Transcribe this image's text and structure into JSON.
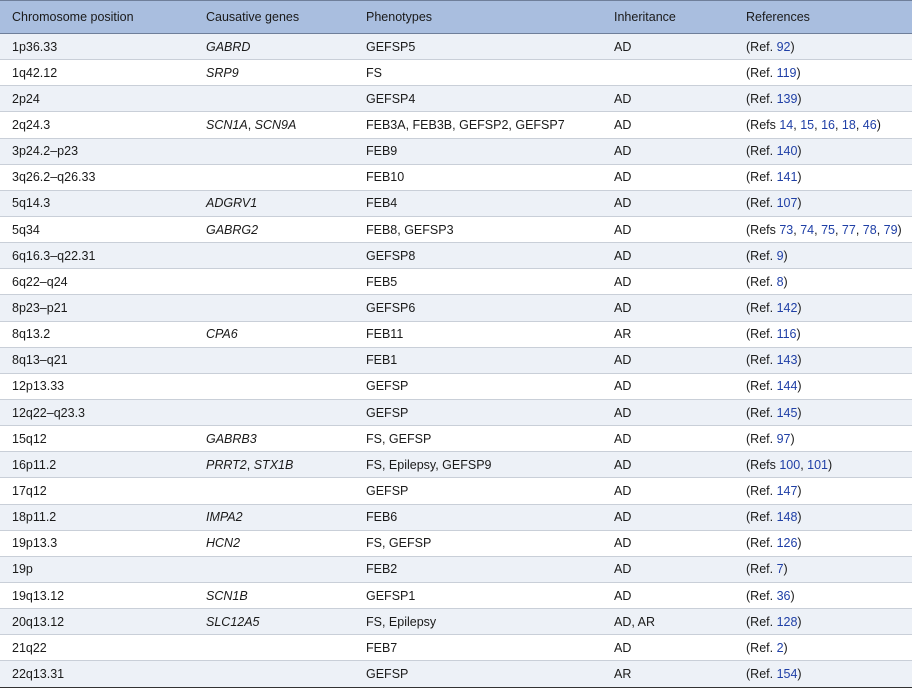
{
  "headers": {
    "position": "Chromosome position",
    "genes": "Causative genes",
    "phenotypes": "Phenotypes",
    "inheritance": "Inheritance",
    "references": "References"
  },
  "rows": [
    {
      "position": "1p36.33",
      "genes": [
        {
          "text": "GABRD",
          "italic": true
        }
      ],
      "phenotypes": "GEFSP5",
      "inheritance": "AD",
      "ref_prefix": "(Ref. ",
      "refs": [
        "92"
      ],
      "ref_suffix": ")"
    },
    {
      "position": "1q42.12",
      "genes": [
        {
          "text": "SRP9",
          "italic": true
        }
      ],
      "phenotypes": "FS",
      "inheritance": "",
      "ref_prefix": "(Ref. ",
      "refs": [
        "119"
      ],
      "ref_suffix": ")"
    },
    {
      "position": "2p24",
      "genes": [],
      "phenotypes": "GEFSP4",
      "inheritance": "AD",
      "ref_prefix": "(Ref. ",
      "refs": [
        "139"
      ],
      "ref_suffix": ")"
    },
    {
      "position": "2q24.3",
      "genes": [
        {
          "text": "SCN1A",
          "italic": true
        },
        {
          "text": ", ",
          "italic": false
        },
        {
          "text": "SCN9A",
          "italic": true
        }
      ],
      "phenotypes": "FEB3A, FEB3B, GEFSP2, GEFSP7",
      "inheritance": "AD",
      "ref_prefix": "(Refs ",
      "refs": [
        "14",
        "15",
        "16",
        "18",
        "46"
      ],
      "ref_suffix": ")"
    },
    {
      "position": "3p24.2–p23",
      "genes": [],
      "phenotypes": "FEB9",
      "inheritance": "AD",
      "ref_prefix": "(Ref. ",
      "refs": [
        "140"
      ],
      "ref_suffix": ")"
    },
    {
      "position": "3q26.2–q26.33",
      "genes": [],
      "phenotypes": "FEB10",
      "inheritance": "AD",
      "ref_prefix": "(Ref. ",
      "refs": [
        "141"
      ],
      "ref_suffix": ")"
    },
    {
      "position": "5q14.3",
      "genes": [
        {
          "text": "ADGRV1",
          "italic": true
        }
      ],
      "phenotypes": "FEB4",
      "inheritance": "AD",
      "ref_prefix": "(Ref. ",
      "refs": [
        "107"
      ],
      "ref_suffix": ")"
    },
    {
      "position": "5q34",
      "genes": [
        {
          "text": "GABRG2",
          "italic": true
        }
      ],
      "phenotypes": "FEB8, GEFSP3",
      "inheritance": "AD",
      "ref_prefix": "(Refs ",
      "refs": [
        "73",
        "74",
        "75",
        "77",
        "78",
        "79"
      ],
      "ref_suffix": ")"
    },
    {
      "position": "6q16.3–q22.31",
      "genes": [],
      "phenotypes": "GEFSP8",
      "inheritance": "AD",
      "ref_prefix": "(Ref. ",
      "refs": [
        "9"
      ],
      "ref_suffix": ")"
    },
    {
      "position": "6q22–q24",
      "genes": [],
      "phenotypes": "FEB5",
      "inheritance": "AD",
      "ref_prefix": "(Ref. ",
      "refs": [
        "8"
      ],
      "ref_suffix": ")"
    },
    {
      "position": "8p23–p21",
      "genes": [],
      "phenotypes": "GEFSP6",
      "inheritance": "AD",
      "ref_prefix": "(Ref. ",
      "refs": [
        "142"
      ],
      "ref_suffix": ")"
    },
    {
      "position": "8q13.2",
      "genes": [
        {
          "text": "CPA6",
          "italic": true
        }
      ],
      "phenotypes": "FEB11",
      "inheritance": "AR",
      "ref_prefix": "(Ref. ",
      "refs": [
        "116"
      ],
      "ref_suffix": ")"
    },
    {
      "position": "8q13–q21",
      "genes": [],
      "phenotypes": "FEB1",
      "inheritance": "AD",
      "ref_prefix": "(Ref. ",
      "refs": [
        "143"
      ],
      "ref_suffix": ")"
    },
    {
      "position": "12p13.33",
      "genes": [],
      "phenotypes": "GEFSP",
      "inheritance": "AD",
      "ref_prefix": "(Ref. ",
      "refs": [
        "144"
      ],
      "ref_suffix": ")"
    },
    {
      "position": "12q22–q23.3",
      "genes": [],
      "phenotypes": "GEFSP",
      "inheritance": "AD",
      "ref_prefix": "(Ref. ",
      "refs": [
        "145"
      ],
      "ref_suffix": ")"
    },
    {
      "position": "15q12",
      "genes": [
        {
          "text": "GABRB3",
          "italic": true
        }
      ],
      "phenotypes": "FS, GEFSP",
      "inheritance": "AD",
      "ref_prefix": "(Ref. ",
      "refs": [
        "97"
      ],
      "ref_suffix": ")"
    },
    {
      "position": "16p11.2",
      "genes": [
        {
          "text": "PRRT2",
          "italic": true
        },
        {
          "text": ", ",
          "italic": false
        },
        {
          "text": "STX1B",
          "italic": true
        }
      ],
      "phenotypes": "FS, Epilepsy, GEFSP9",
      "inheritance": "AD",
      "ref_prefix": "(Refs ",
      "refs": [
        "100",
        "101"
      ],
      "ref_suffix": ")"
    },
    {
      "position": "17q12",
      "genes": [],
      "phenotypes": "GEFSP",
      "inheritance": "AD",
      "ref_prefix": "(Ref. ",
      "refs": [
        "147"
      ],
      "ref_suffix": ")"
    },
    {
      "position": "18p11.2",
      "genes": [
        {
          "text": "IMPA2",
          "italic": true
        }
      ],
      "phenotypes": "FEB6",
      "inheritance": "AD",
      "ref_prefix": "(Ref. ",
      "refs": [
        "148"
      ],
      "ref_suffix": ")"
    },
    {
      "position": "19p13.3",
      "genes": [
        {
          "text": "HCN2",
          "italic": true
        }
      ],
      "phenotypes": "FS, GEFSP",
      "inheritance": "AD",
      "ref_prefix": "(Ref. ",
      "refs": [
        "126"
      ],
      "ref_suffix": ")"
    },
    {
      "position": "19p",
      "genes": [],
      "phenotypes": "FEB2",
      "inheritance": "AD",
      "ref_prefix": "(Ref. ",
      "refs": [
        "7"
      ],
      "ref_suffix": ")"
    },
    {
      "position": "19q13.12",
      "genes": [
        {
          "text": "SCN1B",
          "italic": true
        }
      ],
      "phenotypes": "GEFSP1",
      "inheritance": "AD",
      "ref_prefix": "(Ref. ",
      "refs": [
        "36"
      ],
      "ref_suffix": ")"
    },
    {
      "position": "20q13.12",
      "genes": [
        {
          "text": "SLC12A5",
          "italic": true
        }
      ],
      "phenotypes": "FS, Epilepsy",
      "inheritance": "AD, AR",
      "ref_prefix": "(Ref. ",
      "refs": [
        "128"
      ],
      "ref_suffix": ")"
    },
    {
      "position": "21q22",
      "genes": [],
      "phenotypes": "FEB7",
      "inheritance": "AD",
      "ref_prefix": "(Ref. ",
      "refs": [
        "2"
      ],
      "ref_suffix": ")"
    },
    {
      "position": "22q13.31",
      "genes": [],
      "phenotypes": "GEFSP",
      "inheritance": "AR",
      "ref_prefix": "(Ref. ",
      "refs": [
        "154"
      ],
      "ref_suffix": ")"
    }
  ],
  "colors": {
    "header_bg": "#a9bedf",
    "stripe_bg": "#edf1f7",
    "link": "#1f3fa6"
  }
}
